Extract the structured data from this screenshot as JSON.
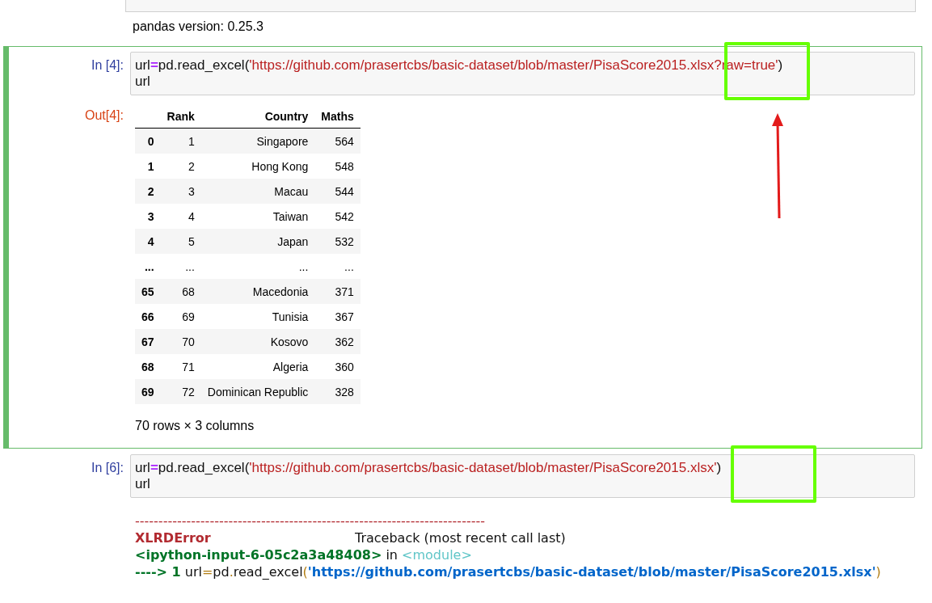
{
  "cells": [
    {
      "kind": "output-only",
      "output": {
        "kind": "stream",
        "text": "pandas version: 0.25.3"
      }
    },
    {
      "kind": "code",
      "prompt": "In [4]:",
      "selected": true,
      "highlight": true,
      "arrow": true,
      "code": [
        [
          {
            "text": "url",
            "kind": "name"
          },
          {
            "text": "=",
            "kind": "op"
          },
          {
            "text": "pd.read_excel(",
            "kind": "name"
          },
          {
            "text": "'https://github.com/prasertcbs/basic-dataset/blob/master/PisaScore2015.xlsx?raw=true'",
            "kind": "str"
          },
          {
            "text": ")",
            "kind": "name"
          }
        ],
        [
          {
            "text": "url",
            "kind": "name"
          }
        ]
      ],
      "output": {
        "kind": "dataframe",
        "prompt": "Out[4]:",
        "columns": [
          "",
          "Rank",
          "Country",
          "Maths"
        ],
        "rows": [
          [
            "0",
            "1",
            "Singapore",
            "564"
          ],
          [
            "1",
            "2",
            "Hong Kong",
            "548"
          ],
          [
            "2",
            "3",
            "Macau",
            "544"
          ],
          [
            "3",
            "4",
            "Taiwan",
            "542"
          ],
          [
            "4",
            "5",
            "Japan",
            "532"
          ],
          [
            "...",
            "...",
            "...",
            "..."
          ],
          [
            "65",
            "68",
            "Macedonia",
            "371"
          ],
          [
            "66",
            "69",
            "Tunisia",
            "367"
          ],
          [
            "67",
            "70",
            "Kosovo",
            "362"
          ],
          [
            "68",
            "71",
            "Algeria",
            "360"
          ],
          [
            "69",
            "72",
            "Dominican Republic",
            "328"
          ]
        ],
        "shape": "70 rows × 3 columns"
      }
    },
    {
      "kind": "code",
      "prompt": "In [6]:",
      "selected": false,
      "highlight": true,
      "arrow": false,
      "code": [
        [
          {
            "text": "url",
            "kind": "name"
          },
          {
            "text": "=",
            "kind": "op"
          },
          {
            "text": "pd.read_excel(",
            "kind": "name"
          },
          {
            "text": "'https://github.com/prasertcbs/basic-dataset/blob/master/PisaScore2015.xlsx'",
            "kind": "str"
          },
          {
            "text": ")",
            "kind": "name"
          }
        ],
        [
          {
            "text": "url",
            "kind": "name"
          }
        ]
      ],
      "output": {
        "kind": "traceback",
        "lines": [
          [
            {
              "text": "---------------------------------------------------------------------------",
              "kind": "rule"
            }
          ],
          [
            {
              "text": "XLRDError",
              "kind": "ename"
            },
            {
              "text": "Traceback (most recent call last)",
              "kind": "plain"
            }
          ],
          [
            {
              "text": "<ipython-input-6-05c2a3a48408>",
              "kind": "file"
            },
            {
              "text": " in ",
              "kind": "plain"
            },
            {
              "text": "<module>",
              "kind": "module"
            }
          ],
          [
            {
              "text": "----> 1",
              "kind": "file"
            },
            {
              "text": " url",
              "kind": "plain"
            },
            {
              "text": "=",
              "kind": "punct"
            },
            {
              "text": "pd",
              "kind": "plain"
            },
            {
              "text": ".",
              "kind": "punct"
            },
            {
              "text": "read_excel",
              "kind": "plain"
            },
            {
              "text": "(",
              "kind": "punct"
            },
            {
              "text": "'https://github.com/prasertcbs/basic-dataset/blob/master/PisaScore2015.xlsx'",
              "kind": "tstr"
            },
            {
              "text": ")",
              "kind": "punct"
            }
          ]
        ]
      }
    }
  ]
}
